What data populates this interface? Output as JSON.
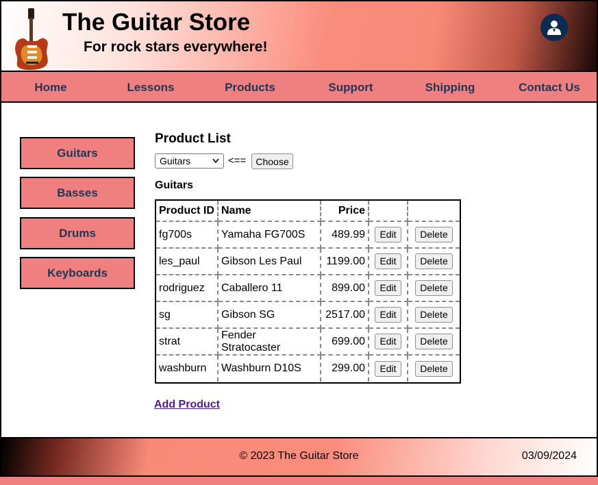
{
  "header": {
    "title": "The Guitar Store",
    "tagline": "For rock stars everywhere!",
    "logo_icon": "electric-guitar",
    "user_icon": "user-account-icon"
  },
  "nav": {
    "items": [
      {
        "label": "Home"
      },
      {
        "label": "Lessons"
      },
      {
        "label": "Products"
      },
      {
        "label": "Support"
      },
      {
        "label": "Shipping"
      },
      {
        "label": "Contact Us"
      }
    ]
  },
  "sidebar": {
    "items": [
      {
        "label": "Guitars"
      },
      {
        "label": "Basses"
      },
      {
        "label": "Drums"
      },
      {
        "label": "Keyboards"
      }
    ]
  },
  "main": {
    "heading": "Product List",
    "category_select": {
      "selected": "Guitars"
    },
    "arrow_text": "<==",
    "choose_label": "Choose",
    "category_heading": "Guitars",
    "table": {
      "headers": [
        "Product ID",
        "Name",
        "Price",
        "",
        ""
      ],
      "rows": [
        {
          "id": "fg700s",
          "name": "Yamaha FG700S",
          "price": "489.99"
        },
        {
          "id": "les_paul",
          "name": "Gibson Les Paul",
          "price": "1199.00"
        },
        {
          "id": "rodriguez",
          "name": "Caballero 11",
          "price": "899.00"
        },
        {
          "id": "sg",
          "name": "Gibson SG",
          "price": "2517.00"
        },
        {
          "id": "strat",
          "name": "Fender Stratocaster",
          "price": "699.00"
        },
        {
          "id": "washburn",
          "name": "Washburn D10S",
          "price": "299.00"
        }
      ],
      "edit_label": "Edit",
      "delete_label": "Delete"
    },
    "add_link": "Add Product"
  },
  "footer": {
    "copyright": "© 2023 The Guitar Store",
    "date": "03/09/2024"
  },
  "colors": {
    "accent": "#f08080",
    "nav_text": "#1f3654",
    "user_icon_bg": "#0d2a50",
    "link": "#551a8b"
  }
}
